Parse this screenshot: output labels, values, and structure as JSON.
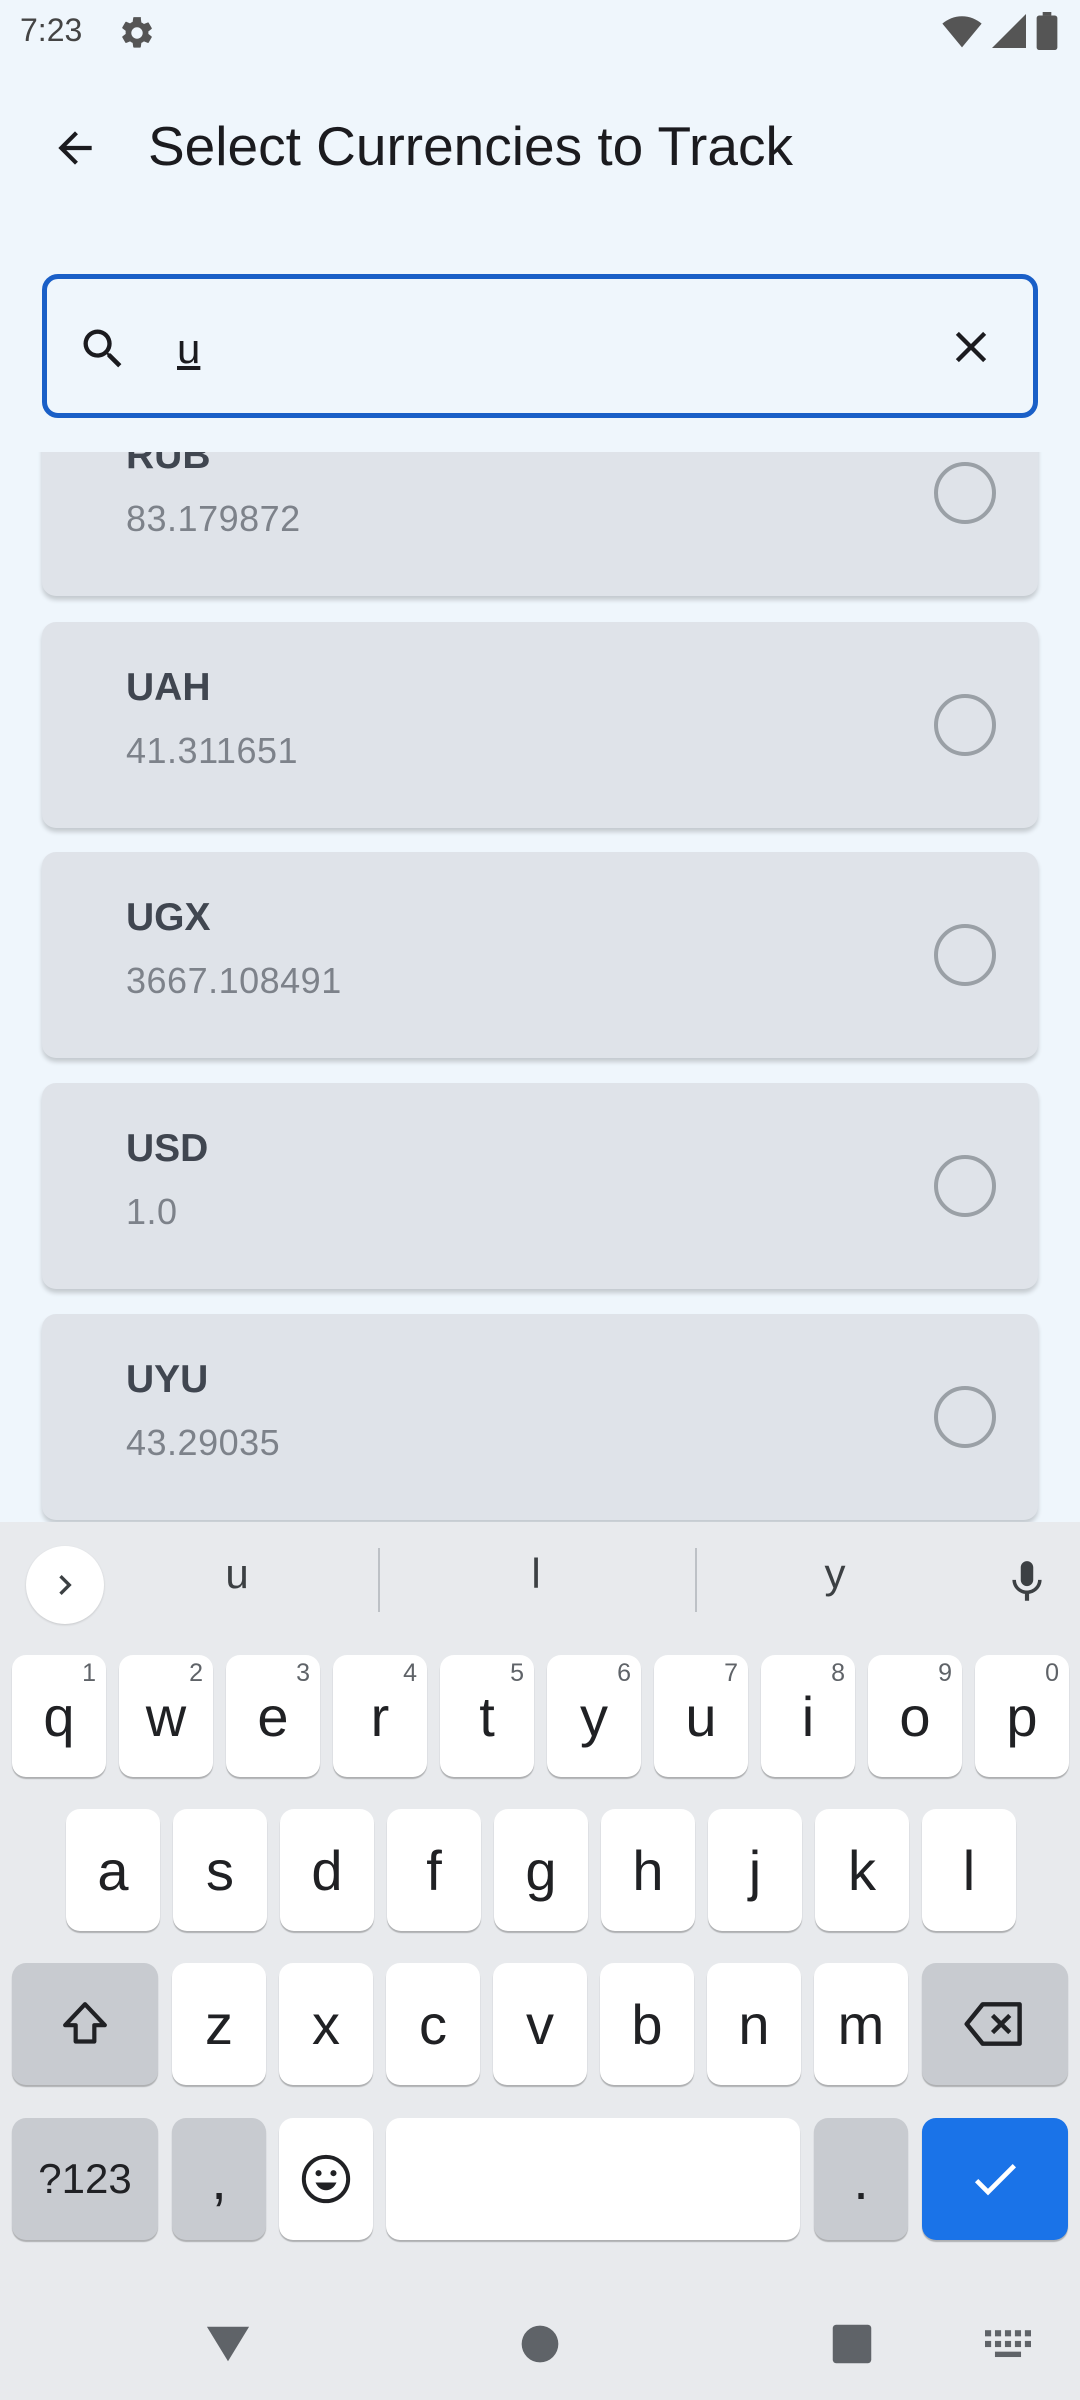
{
  "status_bar": {
    "time": "7:23",
    "icons": [
      "gear-icon",
      "wifi-icon",
      "signal-icon",
      "battery-icon"
    ]
  },
  "app_bar": {
    "back_icon": "arrow-left-icon",
    "title": "Select Currencies to Track"
  },
  "search": {
    "value": "u",
    "placeholder": "",
    "search_icon": "search-icon",
    "clear_icon": "close-icon"
  },
  "currencies": [
    {
      "code": "RUB",
      "rate": "83.179872",
      "selected": false
    },
    {
      "code": "UAH",
      "rate": "41.311651",
      "selected": false
    },
    {
      "code": "UGX",
      "rate": "3667.108491",
      "selected": false
    },
    {
      "code": "USD",
      "rate": "1.0",
      "selected": false
    },
    {
      "code": "UYU",
      "rate": "43.29035",
      "selected": false
    }
  ],
  "keyboard": {
    "suggestions": [
      "u",
      "l",
      "y"
    ],
    "row1": [
      {
        "key": "q",
        "hint": "1"
      },
      {
        "key": "w",
        "hint": "2"
      },
      {
        "key": "e",
        "hint": "3"
      },
      {
        "key": "r",
        "hint": "4"
      },
      {
        "key": "t",
        "hint": "5"
      },
      {
        "key": "y",
        "hint": "6"
      },
      {
        "key": "u",
        "hint": "7"
      },
      {
        "key": "i",
        "hint": "8"
      },
      {
        "key": "o",
        "hint": "9"
      },
      {
        "key": "p",
        "hint": "0"
      }
    ],
    "row2": [
      "a",
      "s",
      "d",
      "f",
      "g",
      "h",
      "j",
      "k",
      "l"
    ],
    "row3": [
      "z",
      "x",
      "c",
      "v",
      "b",
      "n",
      "m"
    ],
    "symbols_label": "?123",
    "comma": ",",
    "period": ".",
    "space_label": ""
  },
  "colors": {
    "accent": "#1a5fc7",
    "enter_key": "#1a73e8",
    "card_bg": "#dfe3e9",
    "page_bg": "#eff6fc"
  }
}
